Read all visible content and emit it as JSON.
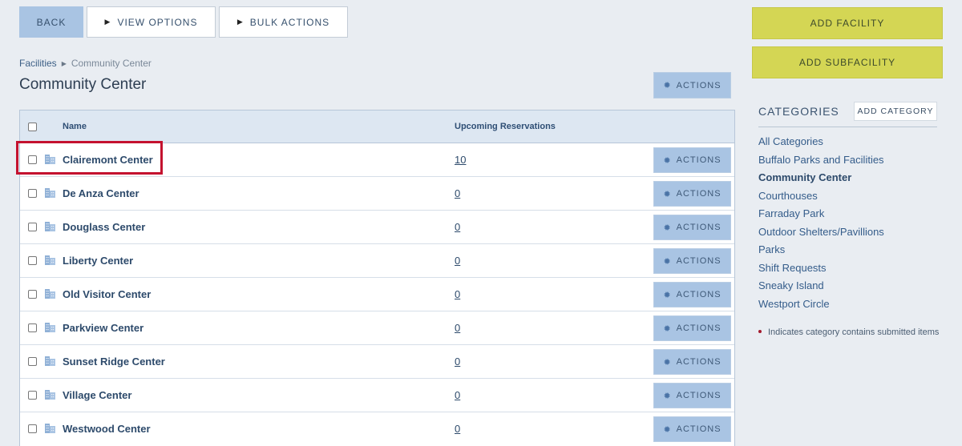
{
  "toolbar": {
    "back_label": "BACK",
    "view_options_label": "VIEW OPTIONS",
    "bulk_actions_label": "BULK ACTIONS"
  },
  "breadcrumb": {
    "root": "Facilities",
    "current": "Community Center"
  },
  "page_title": "Community Center",
  "actions_label": "ACTIONS",
  "table": {
    "headers": {
      "name": "Name",
      "reservations": "Upcoming Reservations"
    },
    "rows": [
      {
        "name": "Clairemont Center",
        "reservations": "10"
      },
      {
        "name": "De Anza Center",
        "reservations": "0"
      },
      {
        "name": "Douglass Center",
        "reservations": "0"
      },
      {
        "name": "Liberty Center",
        "reservations": "0"
      },
      {
        "name": "Old Visitor Center",
        "reservations": "0"
      },
      {
        "name": "Parkview Center",
        "reservations": "0"
      },
      {
        "name": "Sunset Ridge Center",
        "reservations": "0"
      },
      {
        "name": "Village Center",
        "reservations": "0"
      },
      {
        "name": "Westwood Center",
        "reservations": "0"
      }
    ]
  },
  "sidebar": {
    "add_facility_label": "ADD FACILITY",
    "add_subfacility_label": "ADD SUBFACILITY",
    "categories_heading": "CATEGORIES",
    "add_category_label": "ADD CATEGORY",
    "categories": [
      {
        "label": "All Categories",
        "active": false
      },
      {
        "label": "Buffalo Parks and Facilities",
        "active": false
      },
      {
        "label": "Community Center",
        "active": true
      },
      {
        "label": "Courthouses",
        "active": false
      },
      {
        "label": "Farraday Park",
        "active": false
      },
      {
        "label": "Outdoor Shelters/Pavillions",
        "active": false
      },
      {
        "label": "Parks",
        "active": false
      },
      {
        "label": "Shift Requests",
        "active": false
      },
      {
        "label": "Sneaky Island",
        "active": false
      },
      {
        "label": "Westport Circle",
        "active": false
      }
    ],
    "legend_text": "Indicates category contains submitted items"
  },
  "colors": {
    "background": "#e9edf2",
    "primary_button": "#a9c4e3",
    "accent_button": "#d4d654",
    "highlight": "#c4122f",
    "link": "#345c8a"
  },
  "icons": {
    "row_icon": "building-icon",
    "actions_icon": "gear-icon",
    "triangle": "triangle-right-icon"
  }
}
